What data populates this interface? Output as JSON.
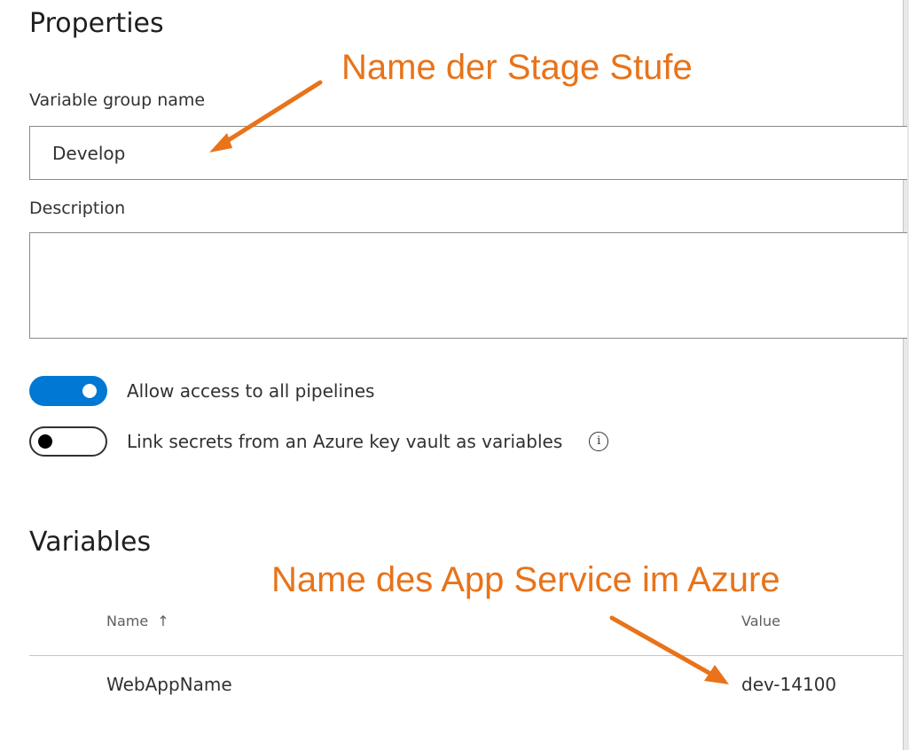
{
  "properties": {
    "heading": "Properties",
    "variable_group_name_label": "Variable group name",
    "variable_group_name_value": "Develop",
    "description_label": "Description",
    "description_value": ""
  },
  "toggles": {
    "allow_access": {
      "label": "Allow access to all pipelines",
      "state": "on"
    },
    "link_secrets": {
      "label": "Link secrets from an Azure key vault as variables",
      "state": "off"
    }
  },
  "variables": {
    "heading": "Variables",
    "columns": [
      "Name",
      "Value"
    ],
    "sort_indicator": "↑",
    "rows": [
      {
        "name": "WebAppName",
        "value": "dev-14100"
      }
    ]
  },
  "annotations": {
    "stage_name": "Name der Stage Stufe",
    "app_service_name": "Name des App Service im Azure"
  },
  "colors": {
    "accent": "#0078d4",
    "annotation": "#e8731a"
  },
  "icons": {
    "info": "info-icon",
    "sort": "sort-ascending-icon"
  }
}
